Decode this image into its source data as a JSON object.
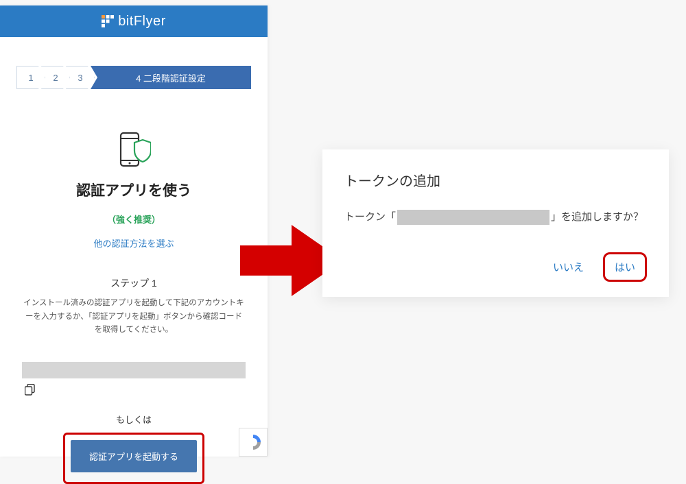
{
  "header": {
    "brand": "bitFlyer"
  },
  "stepper": {
    "steps": [
      "1",
      "2",
      "3"
    ],
    "active": "4 二段階認証設定"
  },
  "main": {
    "title": "認証アプリを使う",
    "recommend": "（強く推奨）",
    "alt_link": "他の認証方法を選ぶ",
    "step_label": "ステップ 1",
    "step_desc": "インストール済みの認証アプリを起動して下記のアカウントキーを入力するか、「認証アプリを起動」ボタンから確認コードを取得してください。",
    "or_text": "もしくは",
    "launch_btn": "認証アプリを起動する"
  },
  "dialog": {
    "title": "トークンの追加",
    "body_prefix": "トークン「",
    "body_suffix": "」を追加しますか？",
    "no": "いいえ",
    "yes": "はい"
  }
}
